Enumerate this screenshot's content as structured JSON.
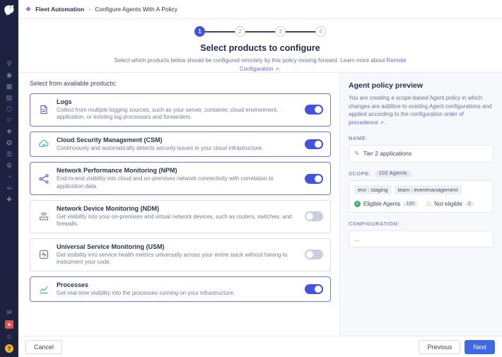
{
  "colors": {
    "sidebar_bg": "#1c2240",
    "accent_blue": "#4353e0",
    "next_button": "#3f68e8",
    "link": "#5f6ce0",
    "active_card_border": "#6b79ea",
    "success_green": "#3bb273",
    "warning_yellow": "#e7a43a"
  },
  "sidebar": {
    "icons": [
      {
        "name": "search-icon",
        "glyph": "⚲"
      },
      {
        "name": "watchdog-icon",
        "glyph": "◉"
      },
      {
        "name": "dashboards-icon",
        "glyph": "▦"
      },
      {
        "name": "notebooks-icon",
        "glyph": "▤"
      },
      {
        "name": "infrastructure-icon",
        "glyph": "⬡"
      },
      {
        "name": "monitors-icon",
        "glyph": "⚐"
      },
      {
        "name": "apm-icon",
        "glyph": "❖"
      },
      {
        "name": "security-icon",
        "glyph": "✪"
      },
      {
        "name": "logs-nav-icon",
        "glyph": "☰"
      },
      {
        "name": "synthetics-icon",
        "glyph": "⚙"
      },
      {
        "name": "rum-icon",
        "glyph": "◔"
      },
      {
        "name": "ci-icon",
        "glyph": "∞"
      },
      {
        "name": "integrations-icon",
        "glyph": "✚"
      }
    ],
    "bottom": {
      "chat_glyph": "✉",
      "releases_glyph": "✦",
      "people_glyph": "☺",
      "help_glyph": "?"
    }
  },
  "topbar": {
    "breadcrumb_root": "Fleet Automation",
    "breadcrumb_separator": "›",
    "breadcrumb_current": "Configure Agents With A Policy"
  },
  "stepper": {
    "steps": [
      "1",
      "2",
      "3",
      "4"
    ]
  },
  "header": {
    "title": "Select products to configure",
    "subtitle_before": "Select which products below should be configured remotely by this policy moving forward. Learn more about",
    "subtitle_link": "Remote Configuration",
    "subtitle_link_icon": "↗",
    "subtitle_suffix": "."
  },
  "products": {
    "section_label": "Select from available products:",
    "items": [
      {
        "name": "Logs",
        "desc": "Collect from multiple logging sources, such as your server, container, cloud environment, application, or existing log processors and forwarders.",
        "state": "on"
      },
      {
        "name": "Cloud Security Management (CSM)",
        "desc": "Continuously and automatically detects security issues in your cloud infrastructure.",
        "state": "on"
      },
      {
        "name": "Network Performance Monitoring (NPM)",
        "desc": "End-to-end visibility into cloud and on-premises network connectivity with correlation to application data.",
        "state": "on"
      },
      {
        "name": "Network Device Monitoring (NDM)",
        "desc": "Get visibility into your on-premises and virtual network devices, such as routers, switches, and firewalls.",
        "state": "off"
      },
      {
        "name": "Universal Service Monitoring (USM)",
        "desc": "Get visibility into service health metrics universally across your entire stack without having to instrument your code.",
        "state": "off"
      },
      {
        "name": "Processes",
        "desc": "Get real-time visibility into the processes running on your infrastructure.",
        "state": "on"
      }
    ]
  },
  "preview": {
    "title": "Agent policy preview",
    "description": "You are creating a scope-based Agent policy in which changes are additive to existing Agent configurations and applied according to the configuration",
    "description_link": "order of precedence",
    "description_link_icon": "↗",
    "description_suffix": ".",
    "name_label": "NAME:",
    "name_value": "Tier 2 applications",
    "edit_glyph": "✎",
    "scope_label": "SCOPE:",
    "scope_badge": "102 Agents",
    "tags": [
      "env : staging",
      "team : eventmanagement"
    ],
    "eligible_check_glyph": "✓",
    "eligible_label": "Eligible Agents",
    "eligible_count": "100",
    "warning_glyph": "⚠",
    "not_eligible_label": "Not eligible",
    "not_eligible_count": "2",
    "config_label": "CONFIGURATION:",
    "config_value": "..."
  },
  "footer": {
    "cancel": "Cancel",
    "previous": "Previous",
    "next": "Next"
  }
}
